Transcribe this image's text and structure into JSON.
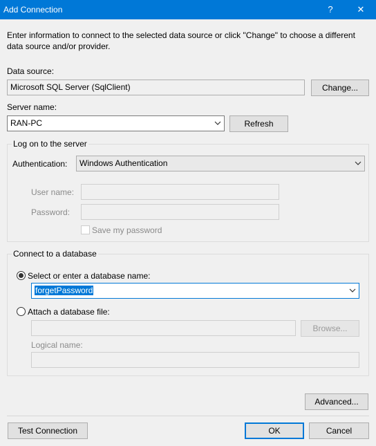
{
  "window": {
    "title": "Add Connection",
    "help_glyph": "?",
    "close_glyph": "✕"
  },
  "intro": "Enter information to connect to the selected data source or click \"Change\" to choose a different data source and/or provider.",
  "data_source": {
    "label": "Data source:",
    "value": "Microsoft SQL Server (SqlClient)",
    "change_label": "Change..."
  },
  "server": {
    "label": "Server name:",
    "value": "RAN-PC",
    "refresh_label": "Refresh"
  },
  "logon": {
    "group_title": "Log on to the server",
    "auth_label": "Authentication:",
    "auth_value": "Windows Authentication",
    "username_label": "User name:",
    "username_value": "",
    "password_label": "Password:",
    "password_value": "",
    "save_password_label": "Save my password",
    "save_password_checked": false
  },
  "database": {
    "group_title": "Connect to a database",
    "select_option_label": "Select or enter a database name:",
    "select_option_selected": true,
    "database_name": "forgetPassword",
    "attach_option_label": "Attach a database file:",
    "attach_option_selected": false,
    "attach_file_value": "",
    "browse_label": "Browse...",
    "logical_name_label": "Logical name:",
    "logical_name_value": ""
  },
  "buttons": {
    "advanced": "Advanced...",
    "test_connection": "Test Connection",
    "ok": "OK",
    "cancel": "Cancel"
  }
}
